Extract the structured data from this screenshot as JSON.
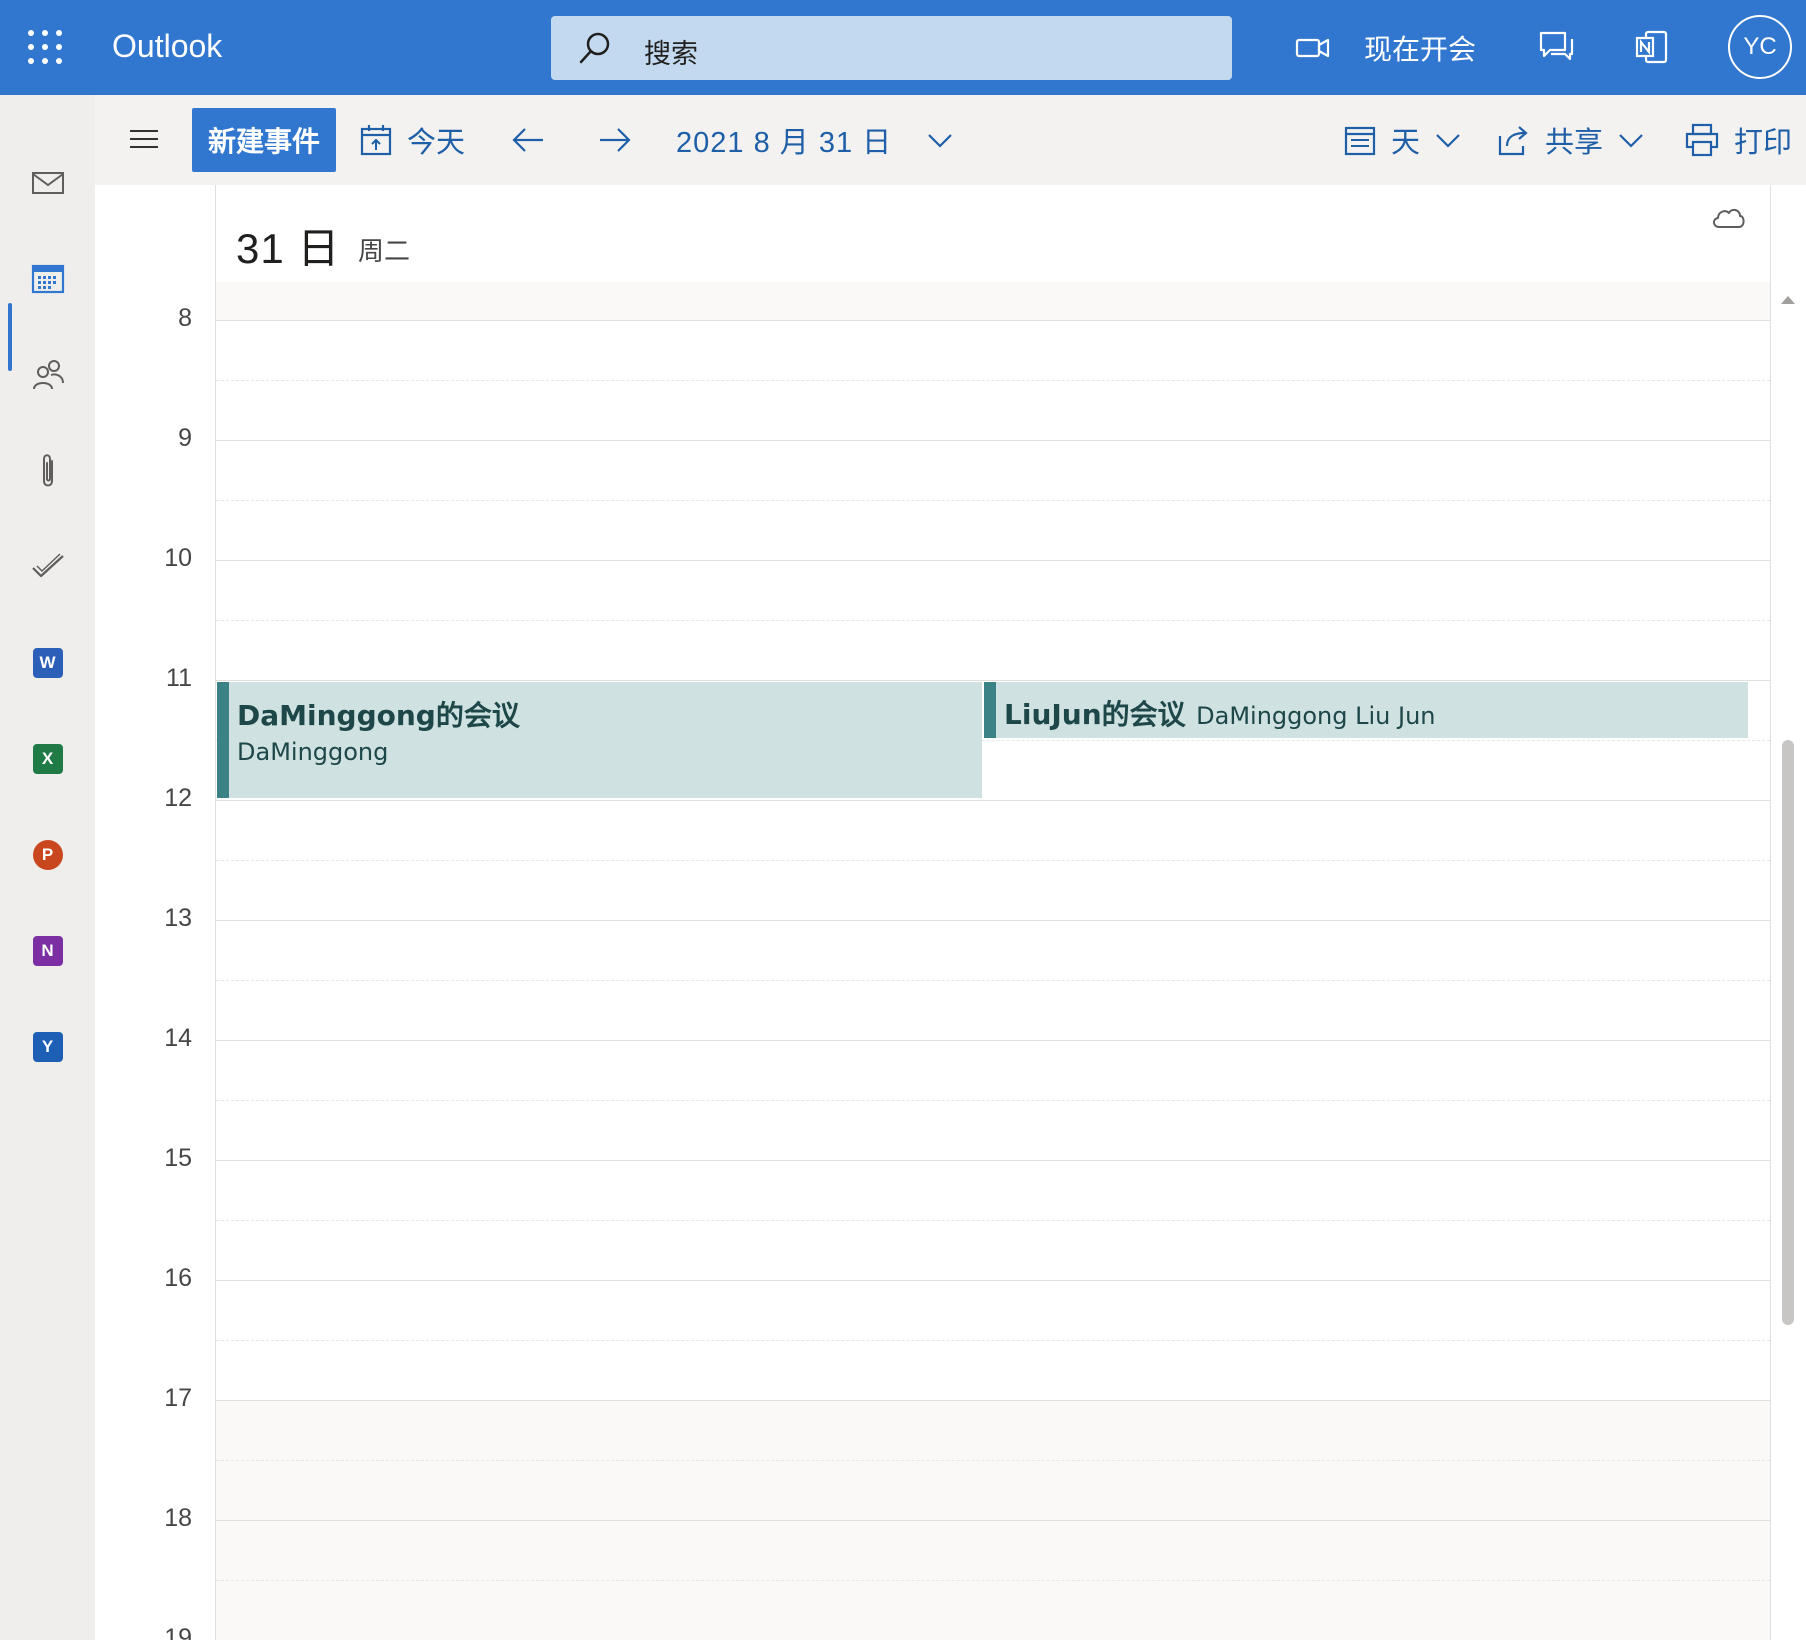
{
  "app": {
    "title": "Outlook"
  },
  "topbar": {
    "search_placeholder": "搜索",
    "meet_now_label": "现在开会",
    "avatar_initials": "YC",
    "accent_color": "#3177cf"
  },
  "rail": {
    "items": [
      {
        "name": "mail",
        "icon": "mail-icon"
      },
      {
        "name": "calendar",
        "icon": "calendar-icon",
        "active": true
      },
      {
        "name": "people",
        "icon": "people-icon"
      },
      {
        "name": "files",
        "icon": "paperclip-icon"
      },
      {
        "name": "todo",
        "icon": "checkmark-icon"
      },
      {
        "name": "word",
        "icon": "word-icon",
        "letter": "W",
        "color": "#2b5fb8"
      },
      {
        "name": "excel",
        "icon": "excel-icon",
        "letter": "X",
        "color": "#1f7a45"
      },
      {
        "name": "powerpoint",
        "icon": "powerpoint-icon",
        "letter": "P",
        "color": "#c9471f"
      },
      {
        "name": "onenote",
        "icon": "onenote-icon",
        "letter": "N",
        "color": "#7b2fa3"
      },
      {
        "name": "yammer",
        "icon": "yammer-icon",
        "letter": "Y",
        "color": "#1d5fb5"
      }
    ]
  },
  "toolbar": {
    "new_event_label": "新建事件",
    "today_label": "今天",
    "date_label": "2021 8 月 31 日",
    "view_label": "天",
    "share_label": "共享",
    "print_label": "打印"
  },
  "day": {
    "day_number": "31 日",
    "weekday": "周二"
  },
  "hours": [
    "8",
    "9",
    "10",
    "11",
    "12",
    "13",
    "14",
    "15",
    "16",
    "17",
    "18",
    "19"
  ],
  "events": [
    {
      "title": "DaMinggong的会议",
      "subtitle": "DaMinggong",
      "color": "#cfe1e0",
      "accent": "#3b8286"
    },
    {
      "title": "LiuJun的会议",
      "subtitle": "DaMinggong Liu Jun",
      "color": "#cfe1e0",
      "accent": "#3b8286"
    }
  ]
}
